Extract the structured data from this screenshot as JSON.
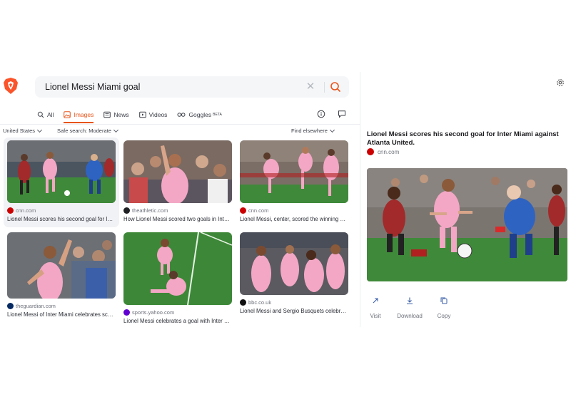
{
  "search": {
    "query": "Lionel Messi Miami goal"
  },
  "tabs": [
    {
      "label": "All",
      "icon": "search-icon"
    },
    {
      "label": "Images",
      "icon": "image-icon"
    },
    {
      "label": "News",
      "icon": "news-icon"
    },
    {
      "label": "Videos",
      "icon": "video-icon"
    },
    {
      "label": "Goggles",
      "icon": "goggles-icon",
      "badge": "BETA"
    }
  ],
  "filters": {
    "region": "United States",
    "safe_search": "Safe search: Moderate",
    "find_elsewhere": "Find elsewhere"
  },
  "results": [
    {
      "source": "cnn.com",
      "title": "Lionel Messi scores his second goal for Inter Miami against Atlanta United."
    },
    {
      "source": "theathletic.com",
      "title": "How Lionel Messi scored two goals in Inter Miami win"
    },
    {
      "source": "cnn.com",
      "title": "Lionel Messi, center, scored the winning goal"
    },
    {
      "source": "theguardian.com",
      "title": "Lionel Messi of Inter Miami celebrates scoring"
    },
    {
      "source": "sports.yahoo.com",
      "title": "Lionel Messi celebrates a goal with Inter Miami teammates"
    },
    {
      "source": "bbc.co.uk",
      "title": "Lionel Messi and Sergio Busquets celebrate"
    }
  ],
  "detail": {
    "title": "Lionel Messi scores his second goal for Inter Miami against Atlanta United.",
    "source": "cnn.com",
    "actions": {
      "visit": "Visit",
      "download": "Download",
      "copy": "Copy"
    }
  },
  "colors": {
    "accent": "#e8541a",
    "pitch": "#3f8a3a",
    "miami_pink": "#f3a7c4",
    "atlanta_red": "#a32a2a",
    "blue_kit": "#2f63c2"
  }
}
